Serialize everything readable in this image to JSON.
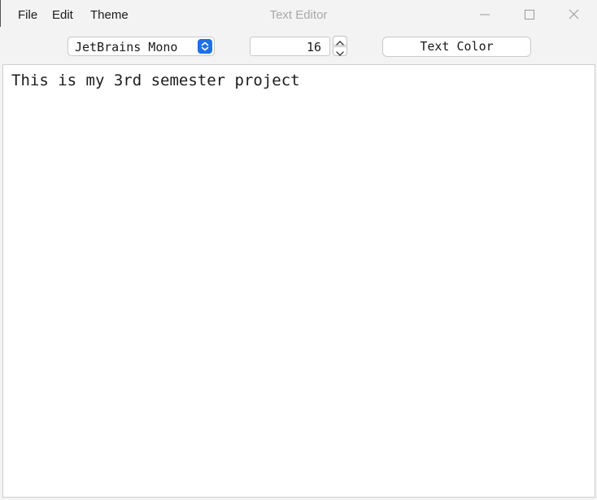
{
  "window": {
    "title": "Text Editor"
  },
  "menu": {
    "items": [
      {
        "label": "File"
      },
      {
        "label": "Edit"
      },
      {
        "label": "Theme"
      }
    ]
  },
  "window_controls": {
    "minimize_icon": "minimize-icon",
    "maximize_icon": "maximize-icon",
    "close_icon": "close-icon"
  },
  "toolbar": {
    "font_select": {
      "value": "JetBrains Mono",
      "icon": "up-down-chevron-icon",
      "accent_color": "#1f6fe5"
    },
    "font_size": {
      "value": "16"
    },
    "text_color_label": "Text Color"
  },
  "editor": {
    "content": "This is my 3rd semester project"
  },
  "colors": {
    "window_background": "#f3f3f3",
    "title_text": "#a8a8a8",
    "editor_background": "#ffffff"
  }
}
